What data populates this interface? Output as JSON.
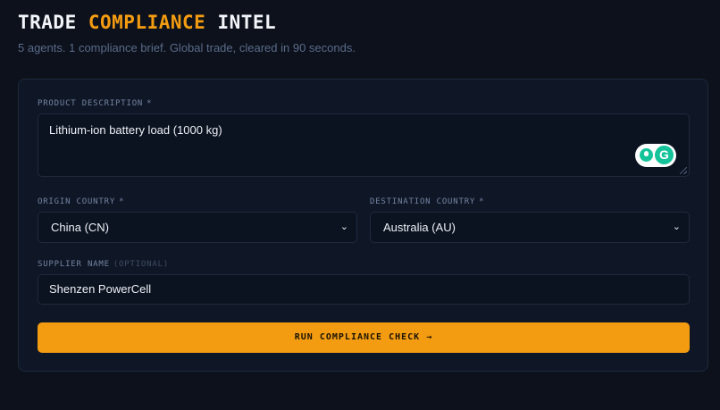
{
  "header": {
    "title_part1": "TRADE",
    "title_accent": "COMPLIANCE",
    "title_part2": "INTEL",
    "subtitle": "5 agents. 1 compliance brief. Global trade, cleared in 90 seconds."
  },
  "form": {
    "product": {
      "label": "PRODUCT DESCRIPTION",
      "required_mark": "*",
      "value": "Lithium-ion battery load (1000 kg)"
    },
    "origin": {
      "label": "ORIGIN COUNTRY",
      "required_mark": "*",
      "selected": "China (CN)"
    },
    "destination": {
      "label": "DESTINATION COUNTRY",
      "required_mark": "*",
      "selected": "Australia (AU)"
    },
    "supplier": {
      "label": "SUPPLIER NAME",
      "optional_mark": "(OPTIONAL)",
      "value": "Shenzen PowerCell"
    },
    "submit_label": "RUN COMPLIANCE CHECK →"
  },
  "grammarly": {
    "icon": "grammarly-icon",
    "letter": "G"
  },
  "colors": {
    "accent": "#f39c12",
    "background": "#0c111b",
    "card": "#0f1726",
    "grammarly": "#15c39a"
  }
}
